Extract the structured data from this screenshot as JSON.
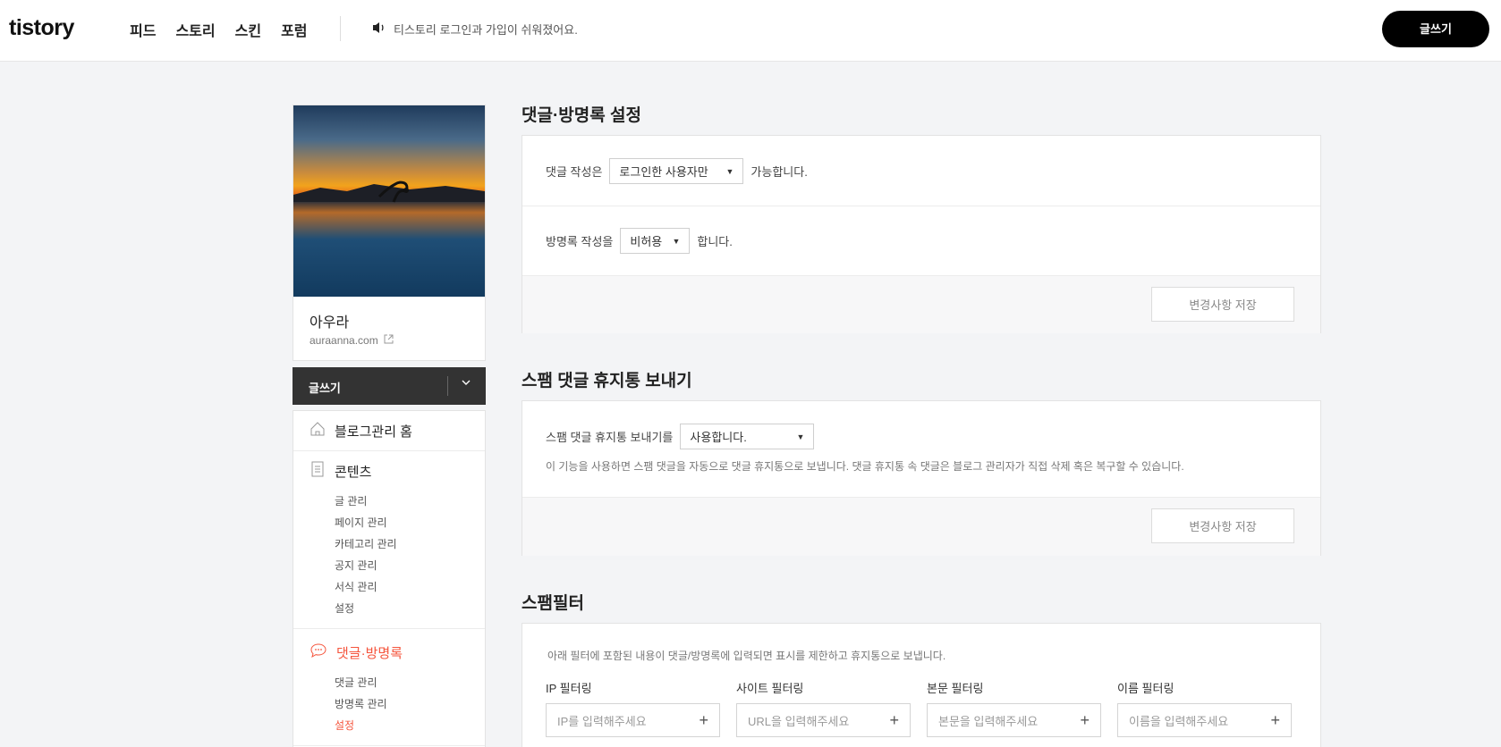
{
  "header": {
    "logo": "tistory",
    "nav": [
      "피드",
      "스토리",
      "스킨",
      "포럼"
    ],
    "notice": "티스토리 로그인과 가입이 쉬워졌어요.",
    "write_button": "글쓰기"
  },
  "sidebar": {
    "blog_name": "아우라",
    "blog_url": "auraanna.com",
    "write_button": "글쓰기",
    "menu": {
      "home": "블로그관리 홈",
      "contents": {
        "title": "콘텐츠",
        "items": [
          "글 관리",
          "페이지 관리",
          "카테고리 관리",
          "공지 관리",
          "서식 관리",
          "설정"
        ]
      },
      "comments": {
        "title": "댓글·방명록",
        "items": [
          "댓글 관리",
          "방명록 관리",
          "설정"
        ]
      }
    }
  },
  "comment_settings": {
    "title": "댓글·방명록 설정",
    "comment_prefix": "댓글 작성은",
    "comment_select": "로그인한 사용자만",
    "comment_suffix": "가능합니다.",
    "guestbook_prefix": "방명록 작성을",
    "guestbook_select": "비허용",
    "guestbook_suffix": "합니다.",
    "save": "변경사항 저장"
  },
  "spam_trash": {
    "title": "스팸 댓글 휴지통 보내기",
    "prefix": "스팸 댓글 휴지통 보내기를",
    "select": "사용합니다.",
    "hint": "이 기능을 사용하면 스팸 댓글을 자동으로 댓글 휴지통으로 보냅니다. 댓글 휴지통 속 댓글은 블로그 관리자가 직접 삭제 혹은 복구할 수 있습니다.",
    "save": "변경사항 저장"
  },
  "spam_filter": {
    "title": "스팸필터",
    "hint": "아래 필터에 포함된 내용이 댓글/방명록에 입력되면 표시를 제한하고 휴지통으로 보냅니다.",
    "filters": [
      {
        "label": "IP 필터링",
        "placeholder": "IP를 입력해주세요"
      },
      {
        "label": "사이트 필터링",
        "placeholder": "URL을 입력해주세요"
      },
      {
        "label": "본문 필터링",
        "placeholder": "본문을 입력해주세요"
      },
      {
        "label": "이름 필터링",
        "placeholder": "이름을 입력해주세요"
      }
    ]
  }
}
